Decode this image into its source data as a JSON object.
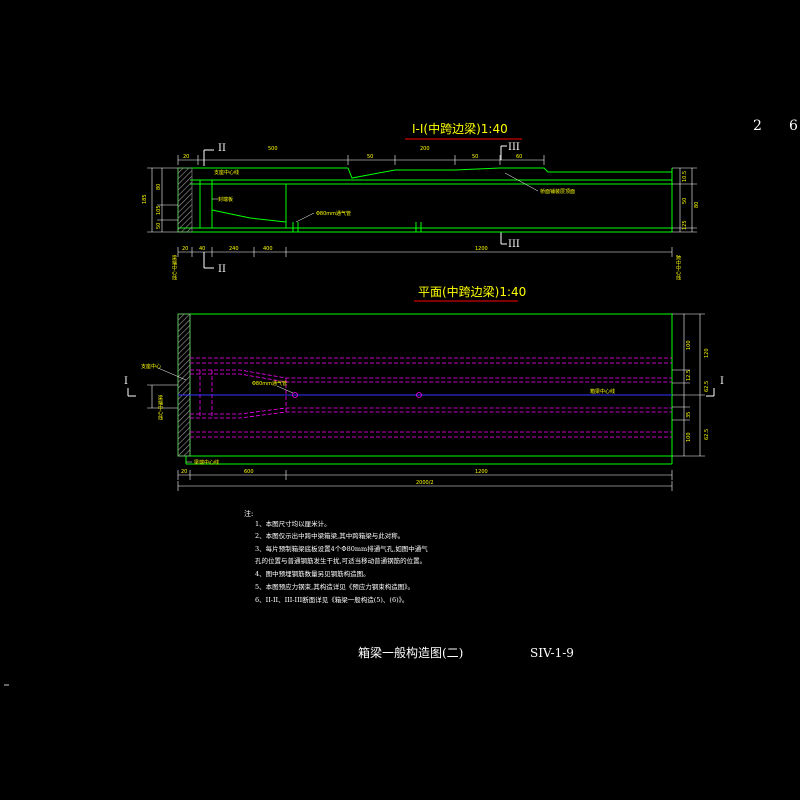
{
  "colors": {
    "background": "#000000",
    "outline": "#00ff00",
    "dimension": "#ffffff",
    "text": "#ffff00",
    "title_underline": "#ff0000",
    "tendon": "#ff00ff",
    "centerline": "#0000ff",
    "hatch": "#888888"
  },
  "sheet": {
    "page_number": "2",
    "page_total": "6"
  },
  "section_view": {
    "title": "I-I(中跨边梁)1:40",
    "cut_top": "II",
    "cut_bottom": "II",
    "cut3_top": "III",
    "cut3_bottom": "III",
    "top_dims": [
      "20",
      "500",
      "50",
      "200",
      "50",
      "60"
    ],
    "bottom_dims": [
      "20",
      "40",
      "240",
      "400",
      "120",
      "1200"
    ],
    "left_dims": [
      "185",
      "80",
      "105",
      "50"
    ],
    "right_dims": [
      "10.5",
      "50",
      "80",
      "125"
    ],
    "labels": {
      "support_center": "支座中心线",
      "end_block": "封端板",
      "vent_pipe": "Φ80mm通气管",
      "deck_note": "桥面铺装层顶面"
    },
    "end_labels": [
      "梁端中心线",
      "跨中中心线"
    ]
  },
  "plan_view": {
    "title": "平面(中跨边梁)1:40",
    "cut_label": "I",
    "left_labels": [
      "支座中心",
      "梁端中心线"
    ],
    "vent_pipe": "Φ80mm通气管",
    "girder_center": "箱梁中心线",
    "bottom_dims": [
      "20",
      "600",
      "1200"
    ],
    "overall_dim": "2000/2",
    "right_dims": [
      "100",
      "120",
      "12.5",
      "35",
      "100"
    ],
    "right_dims_inner": [
      "62.5",
      "62.5"
    ]
  },
  "notes": {
    "heading": "注:",
    "items": [
      "1、本图尺寸均以厘米计。",
      "2、本图仅示出中跨中梁箱梁,其中跨箱梁与此对称。",
      "3、每片预制箱梁底板设置4个Φ80mm排通气孔,如图中通气",
      "   孔的位置与普通钢筋发生干扰,可适当移动普通钢筋的位置。",
      "4、图中预埋钢筋数量另见钢筋构造图。",
      "5、本图预应力钢束,其构造详见《预应力钢束构造图》。",
      "6、II-II、III-III断面详见《箱梁一般构造(5)、(6)》。"
    ]
  },
  "title_block": {
    "drawing_title": "箱梁一般构造图(二)",
    "drawing_number": "SIV-1-9"
  }
}
